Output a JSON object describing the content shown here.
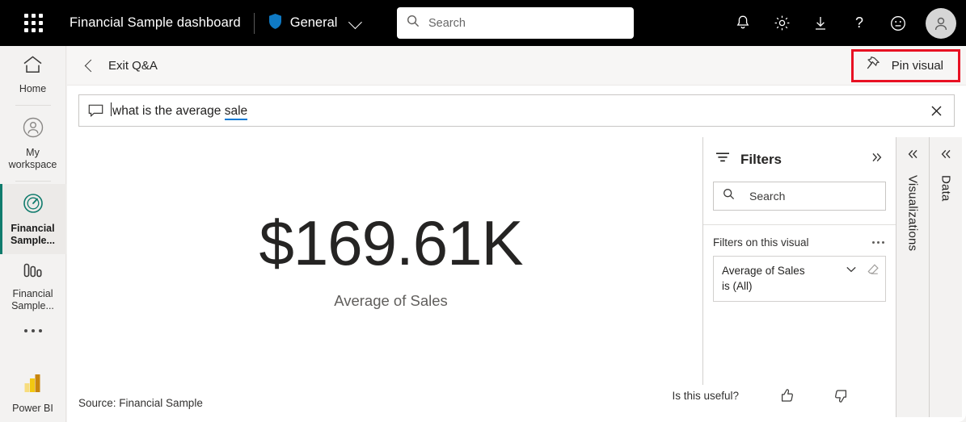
{
  "header": {
    "app_launcher_icon": "waffle-grid-icon",
    "title": "Financial Sample  dashboard",
    "workspace": {
      "icon": "shield-icon",
      "label": "General",
      "chevron": "chevron-down-icon"
    },
    "search": {
      "icon": "search-icon",
      "placeholder": "Search"
    },
    "icons": [
      {
        "name": "notifications-icon",
        "glyph": "bell"
      },
      {
        "name": "settings-icon",
        "glyph": "gear"
      },
      {
        "name": "download-icon",
        "glyph": "arrow-down"
      },
      {
        "name": "help-icon",
        "glyph": "question-mark"
      },
      {
        "name": "feedback-icon",
        "glyph": "smiley"
      },
      {
        "name": "avatar",
        "glyph": "person"
      }
    ],
    "colors": {
      "background": "#000000",
      "shield": "#0f7ac4",
      "text": "#ffffff"
    }
  },
  "sidebar": {
    "items": [
      {
        "label": "Home",
        "icon": "home-icon",
        "selected": false
      },
      {
        "label": "My workspace",
        "icon": "person-circle-icon",
        "selected": false
      },
      {
        "label": "Financial Sample...",
        "icon": "dashboard-gauge-icon",
        "selected": true
      },
      {
        "label": "Financial Sample...",
        "icon": "report-bar-chart-icon",
        "selected": false
      }
    ],
    "more_label": "more-options",
    "footer": {
      "label": "Power BI",
      "icon": "power-bi-logo"
    },
    "accent_color": "#0f7b6c"
  },
  "qna_toolbar": {
    "back_icon": "chevron-left-icon",
    "exit_label": "Exit Q&A",
    "pin_visual": {
      "icon": "pin-icon",
      "label": "Pin visual",
      "highlight_color": "#e81123",
      "highlighted": true
    }
  },
  "question_bar": {
    "icon": "speech-bubble-icon",
    "text_before": "what is the average ",
    "recognized_term": "sale",
    "full_text": "what is the average sale",
    "underline_color": "#0078d4",
    "clear_icon": "close-icon"
  },
  "visual": {
    "value": "$169.61K",
    "label": "Average of Sales",
    "source": "Source: Financial Sample"
  },
  "feedback": {
    "prompt": "Is this useful?",
    "thumbs_up_icon": "thumbs-up-icon",
    "thumbs_down_icon": "thumbs-down-icon"
  },
  "filters_pane": {
    "icon": "filter-icon",
    "title": "Filters",
    "collapse_icon": "chevron-double-right-icon",
    "search": {
      "icon": "search-icon",
      "placeholder": "Search"
    },
    "section_label": "Filters on this visual",
    "section_menu_icon": "more-options-icon",
    "cards": [
      {
        "field": "Average of Sales",
        "value": "is (All)",
        "expand_icon": "chevron-down-icon",
        "clear_icon": "eraser-icon"
      }
    ]
  },
  "right_panels": [
    {
      "title": "Visualizations",
      "expand_icon": "chevron-double-left-icon"
    },
    {
      "title": "Data",
      "expand_icon": "chevron-double-left-icon"
    }
  ],
  "chart_data": {
    "type": "table",
    "title": "Average of Sales",
    "categories": [
      "Average of Sales"
    ],
    "values": [
      169610
    ],
    "display_values": [
      "$169.61K"
    ],
    "annotations": [
      "Source: Financial Sample"
    ]
  }
}
